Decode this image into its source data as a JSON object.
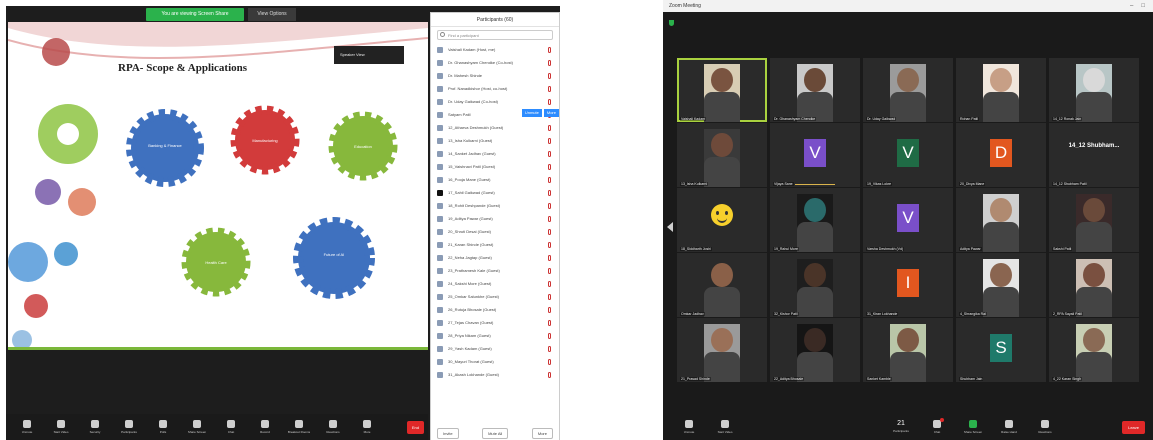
{
  "left_window": {
    "share_banner": "You are viewing Screen Share",
    "view_options": "View Options",
    "slide": {
      "title": "RPA- Scope & Applications",
      "speaker_tag": "Speaker View",
      "gears": [
        {
          "label": "Banking & Finance",
          "color": "#3f71bf"
        },
        {
          "label": "Manufacturing",
          "color": "#d23b3b"
        },
        {
          "label": "Education",
          "color": "#87b83c"
        },
        {
          "label": "Health Care",
          "color": "#87b83c"
        },
        {
          "label": "Future of AI",
          "color": "#3f71bf"
        }
      ]
    },
    "participants_panel": {
      "header": "Participants (60)",
      "search_placeholder": "Find a participant",
      "participants": [
        {
          "name": "Vaishali Kadam (Host, me)"
        },
        {
          "name": "Dr. Ghanashyam Chendke (Co-host)"
        },
        {
          "name": "Dr. Mahesh Shinde"
        },
        {
          "name": "Prof. Nanadkishor (Host, co-host)"
        },
        {
          "name": "Dr. Uday Gaikwad (Co-host)"
        },
        {
          "name": "Satyam Patil"
        },
        {
          "name": "12_Atharva Deshmukh (Guest)"
        },
        {
          "name": "13_Isha Kulkarni (Guest)"
        },
        {
          "name": "14_Sanket Jadhav (Guest)"
        },
        {
          "name": "15_Vaishnavi Patil (Guest)"
        },
        {
          "name": "16_Pooja Mane (Guest)"
        },
        {
          "name": "17_Sahil Gaikwad (Guest)"
        },
        {
          "name": "18_Rohit Deshpande (Guest)"
        },
        {
          "name": "19_Aditya Pawar (Guest)"
        },
        {
          "name": "20_Shruti Desai (Guest)"
        },
        {
          "name": "21_Karan Shinde (Guest)"
        },
        {
          "name": "22_Neha Jagtap (Guest)"
        },
        {
          "name": "23_Prathamesh Kale (Guest)"
        },
        {
          "name": "24_Sakshi More (Guest)"
        },
        {
          "name": "25_Omkar Salunkhe (Guest)"
        },
        {
          "name": "26_Rutuja Bhosale (Guest)"
        },
        {
          "name": "27_Tejas Chavan (Guest)"
        },
        {
          "name": "28_Priya Nikam (Guest)"
        },
        {
          "name": "29_Yash Kadam (Guest)"
        },
        {
          "name": "30_Mayuri Thorat (Guest)"
        },
        {
          "name": "31_Akash Lokhande (Guest)"
        }
      ],
      "row_buttons": [
        "Unmute",
        "More"
      ],
      "footer": [
        "Invite",
        "Mute All",
        "More"
      ]
    },
    "toolbar": [
      "Unmute",
      "Start Video",
      "Security",
      "Participants",
      "Polls",
      "Share Screen",
      "Chat",
      "Record",
      "Breakout Rooms",
      "Reactions",
      "More"
    ],
    "end": "End"
  },
  "right_window": {
    "title": "Zoom Meeting",
    "controls": [
      "–",
      "□"
    ],
    "tiles": [
      {
        "name": "Vaishali Kadam",
        "kind": "video",
        "active": true,
        "skin": "#7a5440",
        "bg": "#d8cdb4"
      },
      {
        "name": "Dr. Ghanashyam Chendke",
        "kind": "video",
        "skin": "#6a4a38",
        "bg": "#c9c9c9"
      },
      {
        "name": "Dr. Uday Gaikwad",
        "kind": "video",
        "skin": "#8a6a55",
        "bg": "#9b9b9b"
      },
      {
        "name": "Rohan Patil",
        "kind": "video",
        "skin": "#c79f86",
        "bg": "#f0e6dc"
      },
      {
        "name": "14_12 Ronak Jain",
        "kind": "video",
        "skin": "#d9d9d9",
        "bg": "#b8c6c6"
      },
      {
        "name": "13_Isha Kulkarni",
        "kind": "video",
        "skin": "#6e4a3a",
        "bg": "#3a3a3a"
      },
      {
        "name": "Vijaya Sane",
        "kind": "letter",
        "letter": "V",
        "color": "#7a4fc9",
        "speaking": true
      },
      {
        "name": "19_Vikas Lokre",
        "kind": "letter",
        "letter": "V",
        "color": "#1f6b45"
      },
      {
        "name": "20_Divya Mane",
        "kind": "letter",
        "letter": "D",
        "color": "#e2571f"
      },
      {
        "name": "14_12 Shubham Patil",
        "kind": "text",
        "display": "14_12 Shubham..."
      },
      {
        "name": "18_Siddharth Joshi",
        "kind": "emoji"
      },
      {
        "name": "19_Rahul More",
        "kind": "video",
        "skin": "#2a6a6a",
        "bg": "#1a1a1a"
      },
      {
        "name": "Varsha Deshmukh (Vd)",
        "kind": "letter",
        "letter": "V",
        "color": "#7a4fc9"
      },
      {
        "name": "Aditya Pawar",
        "kind": "video",
        "skin": "#b08a70",
        "bg": "#cfcfcf"
      },
      {
        "name": "Sakshi Patil",
        "kind": "video",
        "skin": "#6a4a3a",
        "bg": "#3a2a2a"
      },
      {
        "name": "Omkar Jadhav",
        "kind": "video",
        "skin": "#8a6048",
        "bg": "#2a2a2a"
      },
      {
        "name": "32_Kishor Patil",
        "kind": "video",
        "skin": "#4a3428",
        "bg": "#1e1e1e"
      },
      {
        "name": "31_Kiran Lokhande",
        "kind": "letter",
        "letter": "I",
        "color": "#e2571f"
      },
      {
        "name": "4_Shrangika Rai",
        "kind": "video",
        "skin": "#8a6550",
        "bg": "#e5e5e5"
      },
      {
        "name": "2_RPA Sayali Patil",
        "kind": "video",
        "skin": "#7a5040",
        "bg": "#cdbfb4"
      },
      {
        "name": "21_Prasad Shinde",
        "kind": "video",
        "skin": "#9a7058",
        "bg": "#9a9a9a"
      },
      {
        "name": "22_Aditya Bhosale",
        "kind": "video",
        "skin": "#3a2a24",
        "bg": "#151515"
      },
      {
        "name": "Sanket Kamble",
        "kind": "video",
        "skin": "#7d5a45",
        "bg": "#b9c6a8"
      },
      {
        "name": "Shubham Jain",
        "kind": "letter",
        "letter": "S",
        "color": "#1f7a6a"
      },
      {
        "name": "4_22 Karan Singh",
        "kind": "video",
        "skin": "#8a6a55",
        "bg": "#c8cfb4"
      }
    ],
    "toolbar": {
      "left": [
        "Unmute",
        "Start Video"
      ],
      "mid": [
        {
          "label": "Participants",
          "count": "21"
        },
        {
          "label": "Chat"
        },
        {
          "label": "Share Screen"
        },
        {
          "label": "Raise Hand"
        },
        {
          "label": "Reactions"
        }
      ],
      "leave": "Leave"
    }
  }
}
